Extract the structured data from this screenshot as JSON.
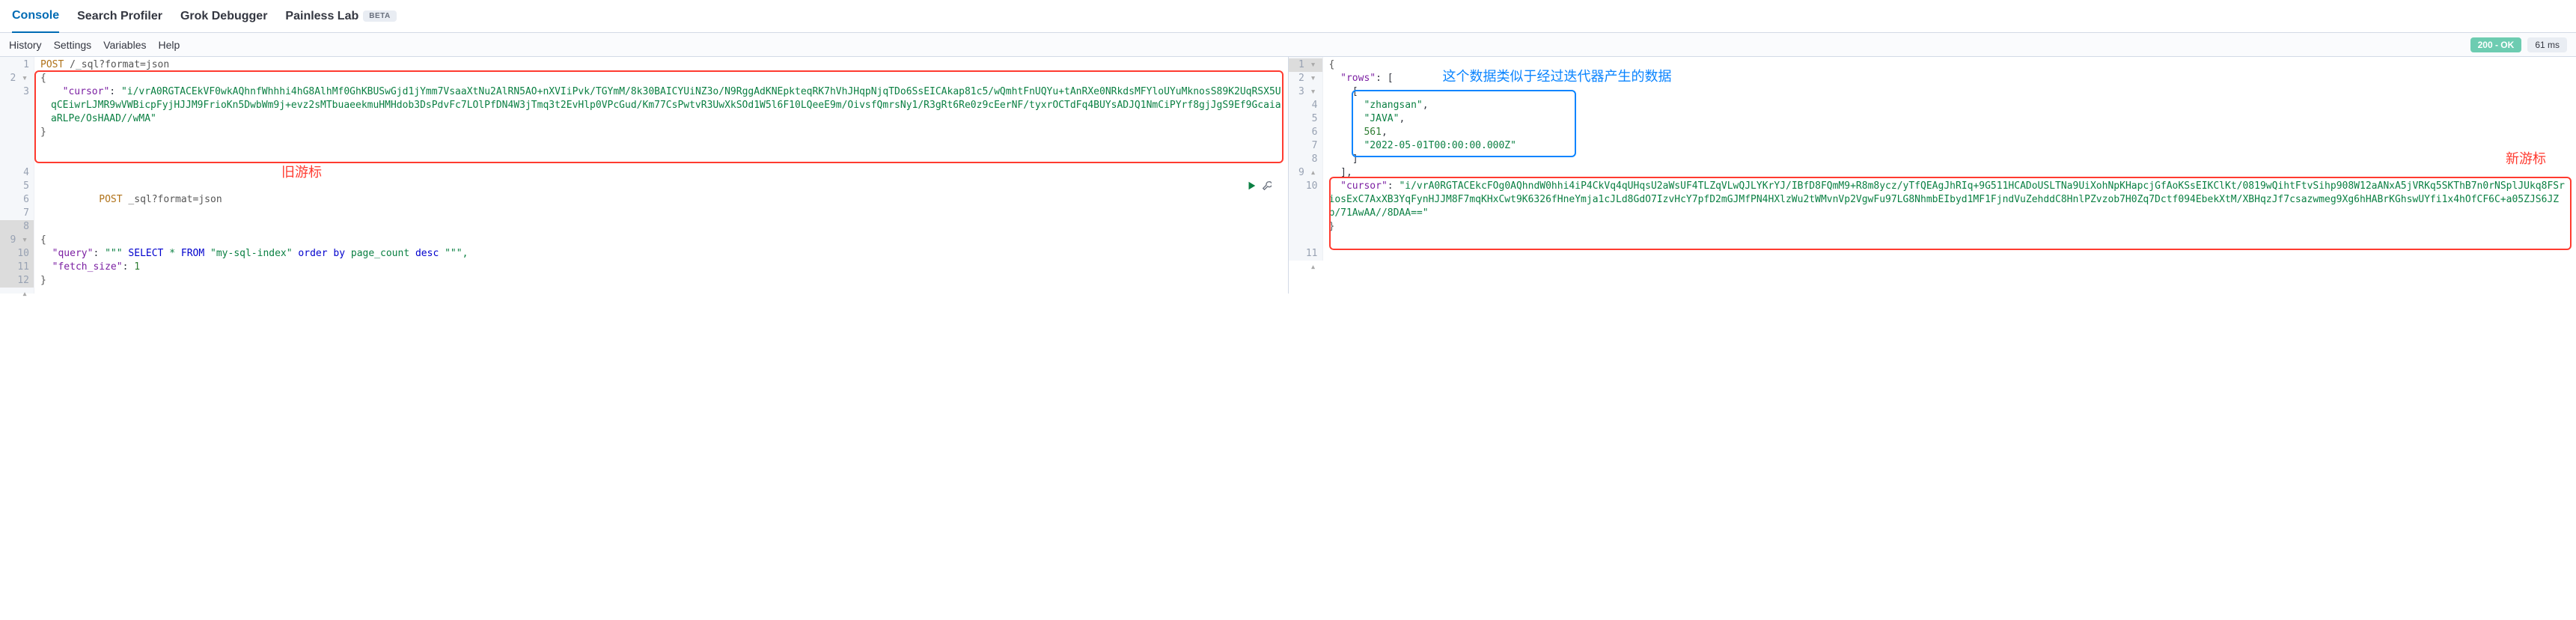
{
  "tabs": {
    "console": "Console",
    "profiler": "Search Profiler",
    "grok": "Grok Debugger",
    "painless": "Painless Lab",
    "beta_badge": "BETA"
  },
  "toolbar": {
    "history": "History",
    "settings": "Settings",
    "variables": "Variables",
    "help": "Help",
    "status": "200 - OK",
    "time": "61 ms"
  },
  "left": {
    "l1_method": "POST",
    "l1_path": " /_sql?format=json",
    "l2": "{",
    "l3_key": "\"cursor\"",
    "l3_val": "\"i/vrA0RGTACEkVF0wkAQhnfWhhhi4hG8AlhMf0GhKBUSwGjd1jYmm7VsaaXtNu2AlRN5AO+nXVIiPvk/TGYmM/8k30BAICYUiNZ3o/N9RggAdKNEpkteqRK7hVhJHqpNjqTDo6SsEICAkap81c5/wQmhtFnUQYu+tAnRXe0NRkdsMFYloUYuMknosS89K2UqRSX5UqCEiwrLJMR9wVWBicpFyjHJJM9FrioKn5DwbWm9j+evz2sMTbuaeekmuHMHdob3DsPdvFc7LOlPfDN4W3jTmq3t2EvHlp0VPcGud/Km77CsPwtvR3UwXkSOd1W5l6F10LQeeE9m/OivsfQmrsNy1/R3gRt6Re0z9cEerNF/tyxrOCTdFq4BUYsADJQ1NmCiPYrf8gjJgS9Ef9GcaiaaRLPe/OsHAAD//wMA\"",
    "l4": "}",
    "l5": "",
    "l6": "",
    "l7": "",
    "l8_method": "POST",
    "l8_path": " _sql?format=json",
    "l9": "{",
    "l10_key_q": "\"query\"",
    "l10_q_pre": "\"\"\" ",
    "l10_sql_select": "SELECT",
    "l10_sql_mid": " * ",
    "l10_sql_from": "FROM",
    "l10_sql_tbl": " \"my-sql-index\" ",
    "l10_sql_order": "order by",
    "l10_sql_col": " page_count ",
    "l10_sql_desc": "desc",
    "l10_q_post": " \"\"\",",
    "l11_key_f": "\"fetch_size\"",
    "l11_val_f": "1",
    "l12": "}",
    "anno_old": "旧游标"
  },
  "right": {
    "l1": "{",
    "l2_key": "\"rows\"",
    "l2_post": ": [",
    "l3": "    [",
    "l4": "\"zhangsan\"",
    "l5": "\"JAVA\"",
    "l6": "561",
    "l7": "\"2022-05-01T00:00:00.000Z\"",
    "l8": "    ]",
    "l9": "  ],",
    "l10_key": "\"cursor\"",
    "l10_val": "\"i/vrA0RGTACEkcFOg0AQhndW0hhi4iP4CkVq4qUHqsU2aWsUF4TLZqVLwQJLYKrYJ/IBfD8FQmM9+R8m8ycz/yTfQEAgJhRIq+9G511HCADoUSLTNa9UiXohNpKHapcjGfAoKSsEIKClKt/0819wQihtFtvSihp908W12aANxA5jVRKq5SKThB7n0rNSplJUkq8FSriosExC7AxXB3YqFynHJJM8F7mqKHxCwt9K6326fHneYmja1cJLd8GdO7IzvHcY7pfD2mGJMfPN4HXlzWu2tWMvnVp2VgwFu97LG8NhmbEIbyd1MF1FjndVuZehddC8HnlPZvzob7H0Zq7Dctf094EbekXtM/XBHqzJf7csazwmeg9Xg6hHABrKGhswUYfi1x4hOfCF6C+a05ZJS6JZb/71AwAA//8DAA==\"",
    "l11": "}",
    "anno_iter": "这个数据类似于经过迭代器产生的数据",
    "anno_new": "新游标"
  }
}
